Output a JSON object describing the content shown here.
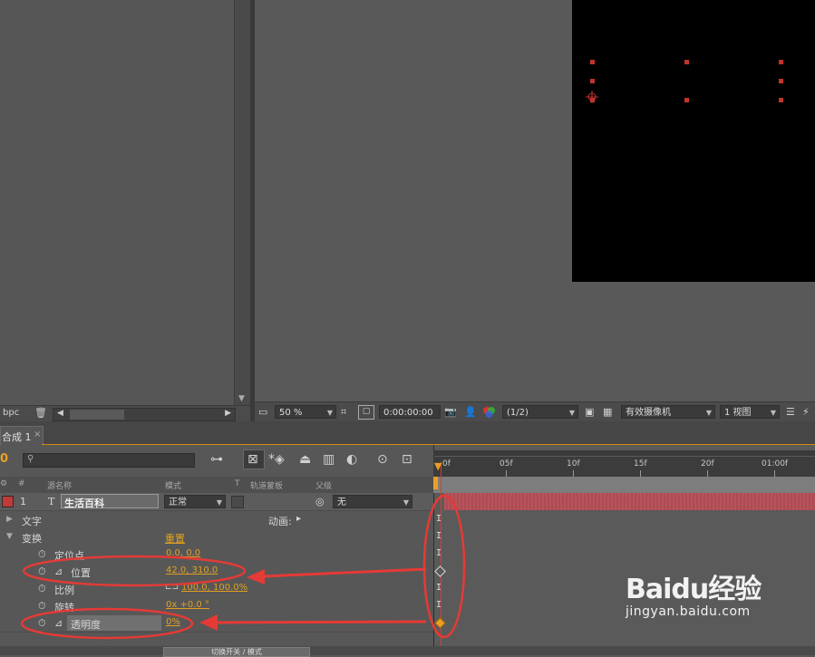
{
  "project": {
    "bpc_label": "bpc"
  },
  "viewer": {
    "zoom": "50 %",
    "timecode": "0:00:00:00",
    "resolution": "(1/2)",
    "camera": "有效摄像机",
    "views": "1 视图"
  },
  "timeline": {
    "tab_label": "合成 1",
    "tab_close": "×",
    "current_time": "0",
    "search_placeholder": "",
    "columns": {
      "label": "#",
      "source_name": "源名称",
      "mode": "模式",
      "t": "T",
      "track_matte": "轨道蒙板",
      "parent": "父级"
    },
    "layer": {
      "index": "1",
      "type_glyph": "T",
      "name": "生活百科",
      "mode": "正常",
      "parent": "无"
    },
    "groups": {
      "text": "文字",
      "animate": "动画:",
      "transform": "变换",
      "reset": "重置"
    },
    "properties": [
      {
        "name": "定位点",
        "value": "0.0, 0.0"
      },
      {
        "name": "位置",
        "value": "42.0, 310.0"
      },
      {
        "name": "比例",
        "value": "100.0, 100.0%"
      },
      {
        "name": "旋转",
        "value": "0x +0.0 °"
      },
      {
        "name": "透明度",
        "value": "0%"
      }
    ],
    "ruler": [
      "0f",
      "05f",
      "10f",
      "15f",
      "20f",
      "01:00f"
    ],
    "switch_button": "切换开关 / 模式"
  },
  "colors": {
    "accent": "#e8a024",
    "annotation": "#e53a36",
    "layer_bar": "#b04a52",
    "label": "#c03a3a"
  },
  "watermark": {
    "main": "Baidu经验",
    "sub": "jingyan.baidu.com"
  }
}
